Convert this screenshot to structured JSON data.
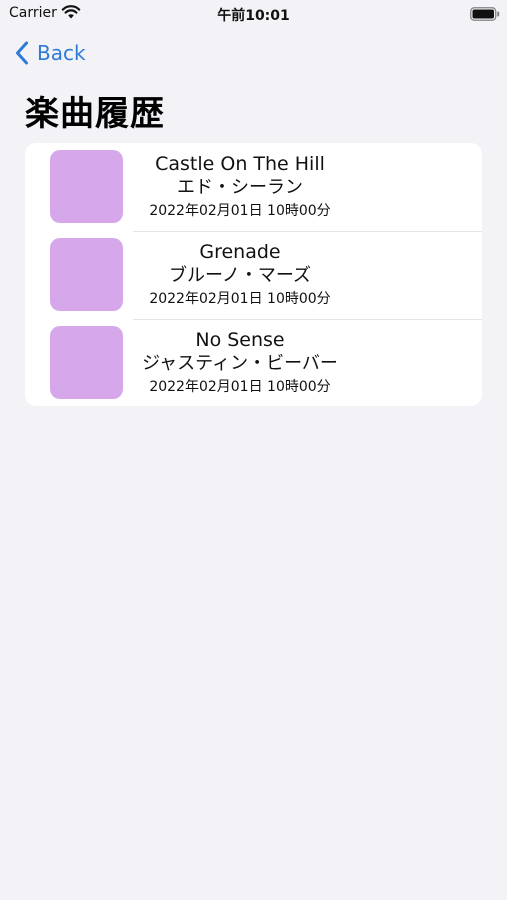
{
  "status_bar": {
    "carrier": "Carrier",
    "time": "午前10:01"
  },
  "nav": {
    "back_label": "Back",
    "title": "楽曲履歴"
  },
  "colors": {
    "accent": "#2d7bd9",
    "artwork_placeholder": "#d6a7ea",
    "background": "#f2f2f7"
  },
  "songs": [
    {
      "title": "Castle On The Hill",
      "artist": "エド・シーラン",
      "played_at": "2022年02月01日 10時00分"
    },
    {
      "title": "Grenade",
      "artist": "ブルーノ・マーズ",
      "played_at": "2022年02月01日 10時00分"
    },
    {
      "title": "No Sense",
      "artist": "ジャスティン・ビーバー",
      "played_at": "2022年02月01日 10時00分"
    }
  ]
}
